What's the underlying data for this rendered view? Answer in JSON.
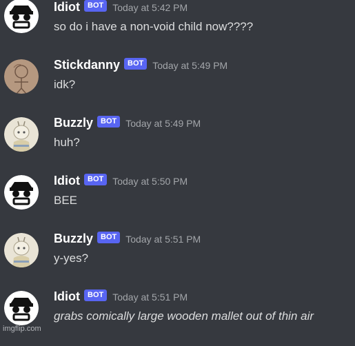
{
  "messages": [
    {
      "author": "Idiot",
      "badge": "BOT",
      "timestamp": "Today at 5:42 PM",
      "text": "so do i have a non-void child now????",
      "avatar": "idiot-face-icon",
      "italic": false
    },
    {
      "author": "Stickdanny",
      "badge": "BOT",
      "timestamp": "Today at 5:49 PM",
      "text": "idk?",
      "avatar": "stickdanny-sketch-icon",
      "italic": false
    },
    {
      "author": "Buzzly",
      "badge": "BOT",
      "timestamp": "Today at 5:49 PM",
      "text": "huh?",
      "avatar": "buzzly-bee-icon",
      "italic": false
    },
    {
      "author": "Idiot",
      "badge": "BOT",
      "timestamp": "Today at 5:50 PM",
      "text": "BEE",
      "avatar": "idiot-face-icon",
      "italic": false
    },
    {
      "author": "Buzzly",
      "badge": "BOT",
      "timestamp": "Today at 5:51 PM",
      "text": "y-yes?",
      "avatar": "buzzly-bee-icon",
      "italic": false
    },
    {
      "author": "Idiot",
      "badge": "BOT",
      "timestamp": "Today at 5:51 PM",
      "text": "grabs comically large wooden mallet out of thin air",
      "avatar": "idiot-face-icon",
      "italic": true
    }
  ],
  "watermark": "imgflip.com",
  "colors": {
    "background": "#36393f",
    "bot_badge": "#5865f2",
    "timestamp": "#a3a6aa",
    "message_text": "#dcddde"
  }
}
